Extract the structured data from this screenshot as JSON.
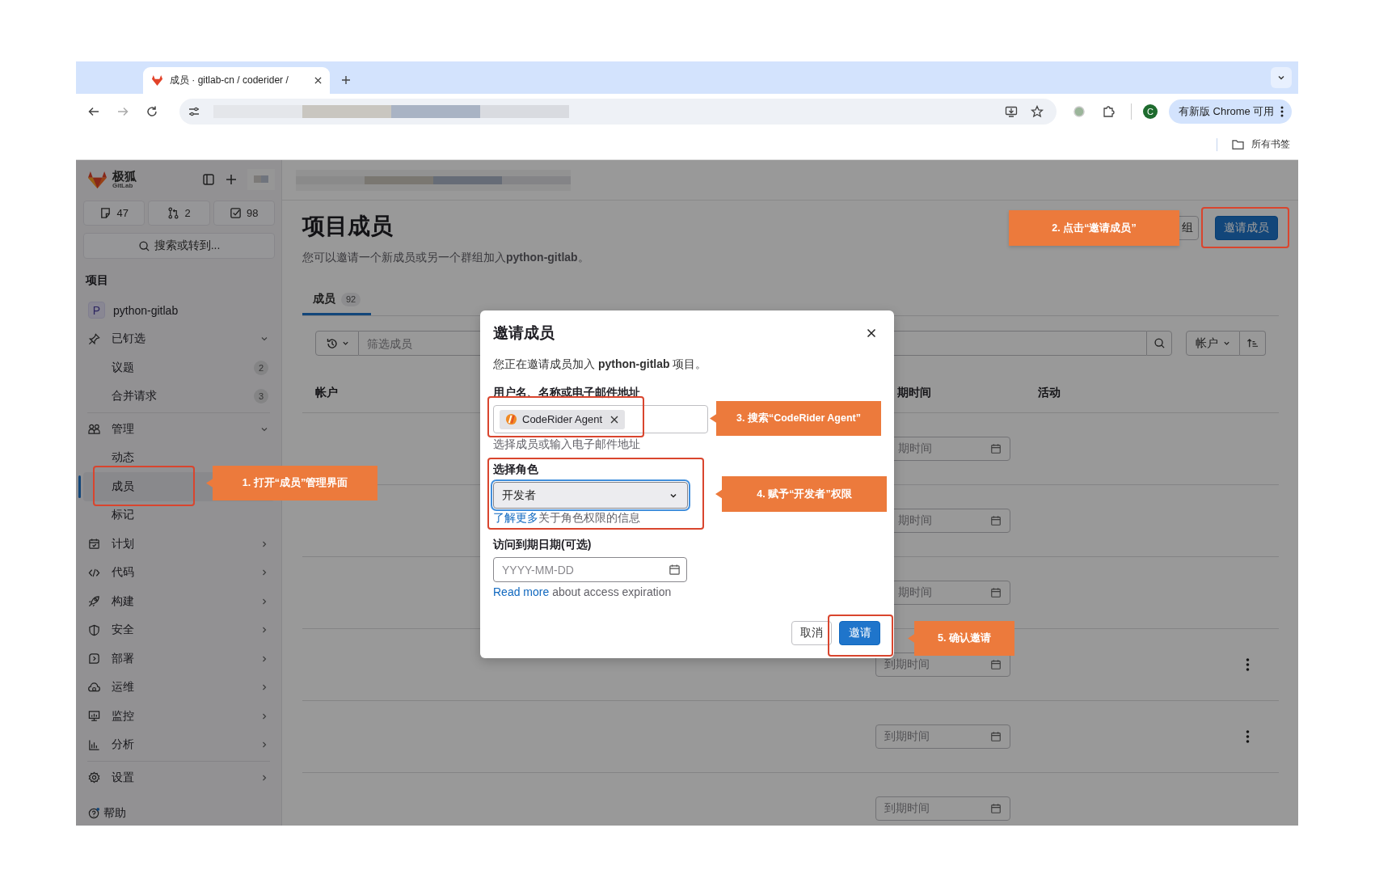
{
  "browser": {
    "tab_title": "成员 · gitlab-cn / coderider /",
    "update_button": "有新版 Chrome 可用",
    "avatar_letter": "C",
    "bookmarks": "所有书签"
  },
  "sidebar": {
    "brand": "极狐",
    "brand_sub": "GitLab",
    "counters": [
      {
        "kind": "issues",
        "count": "47"
      },
      {
        "kind": "merge-requests",
        "count": "2"
      },
      {
        "kind": "todos",
        "count": "98"
      }
    ],
    "search": "搜索或转到...",
    "section": "项目",
    "project": {
      "initial": "P",
      "name": "python-gitlab"
    },
    "items": [
      {
        "label": "已钉选",
        "expanded": true,
        "children": [
          {
            "label": "议题",
            "count": "2",
            "selected": false
          },
          {
            "label": "合并请求",
            "count": "3",
            "selected": false
          }
        ]
      },
      {
        "label": "管理",
        "expanded": true,
        "children": [
          {
            "label": "动态",
            "selected": false
          },
          {
            "label": "成员",
            "selected": true
          },
          {
            "label": "标记",
            "selected": false
          }
        ]
      },
      {
        "label": "计划",
        "expanded": false
      },
      {
        "label": "代码",
        "expanded": false
      },
      {
        "label": "构建",
        "expanded": false
      },
      {
        "label": "安全",
        "expanded": false
      },
      {
        "label": "部署",
        "expanded": false
      },
      {
        "label": "运维",
        "expanded": false
      },
      {
        "label": "监控",
        "expanded": false
      },
      {
        "label": "分析",
        "expanded": false
      },
      {
        "label": "设置",
        "expanded": false
      }
    ],
    "help": "帮助"
  },
  "page": {
    "title": "项目成员",
    "subtitle": "您可以邀请一个新成员或另一个群组加入**python-gitlab**。",
    "buttons": [
      {
        "label": "组",
        "kind": "secondary"
      },
      {
        "label": "邀请成员",
        "kind": "primary"
      }
    ],
    "tabs": [
      {
        "label": "成员",
        "count": "92",
        "selected": true
      }
    ],
    "filter": {
      "placeholder": "筛选成员",
      "sort": "帐户"
    },
    "table": {
      "columns": [
        "帐户",
        "期时间",
        "活动"
      ],
      "rows": [
        {
          "date_placeholder": "期时间",
          "partly_hidden": true,
          "menu": false
        },
        {
          "date_placeholder": "期时间",
          "partly_hidden": true,
          "menu": false
        },
        {
          "date_placeholder": "期时间",
          "partly_hidden": true,
          "menu": false
        },
        {
          "date_placeholder": "到期时间",
          "partly_hidden": false,
          "menu": true
        },
        {
          "date_placeholder": "到期时间",
          "partly_hidden": false,
          "menu": true
        },
        {
          "date_placeholder": "到期时间",
          "partly_hidden": false,
          "menu": false
        }
      ]
    }
  },
  "dialog": {
    "title": "邀请成员",
    "intro": "您正在邀请成员加入 **python-gitlab** 项目。",
    "user_label": "用户名、名称或电子邮件地址",
    "token": "CodeRider Agent",
    "user_help": "选择成员或输入电子邮件地址",
    "role_label": "选择角色",
    "role": {
      "value": "开发者",
      "focused": true
    },
    "role_link": "了解更多",
    "role_help": "关于角色权限的信息",
    "expiry_label": "访问到期日期(可选)",
    "expiry_placeholder": "YYYY-MM-DD",
    "expiry_link": "Read more",
    "expiry_help": " about access expiration",
    "cancel": "取消",
    "invite": "邀请"
  },
  "annotations": [
    {
      "text": "1. 打开“成员”管理界面"
    },
    {
      "text": "2. 点击“邀请成员”"
    },
    {
      "text": "3. 搜索“CodeRider Agent”"
    },
    {
      "text": "4. 赋予“开发者”权限"
    },
    {
      "text": "5. 确认邀请"
    }
  ]
}
